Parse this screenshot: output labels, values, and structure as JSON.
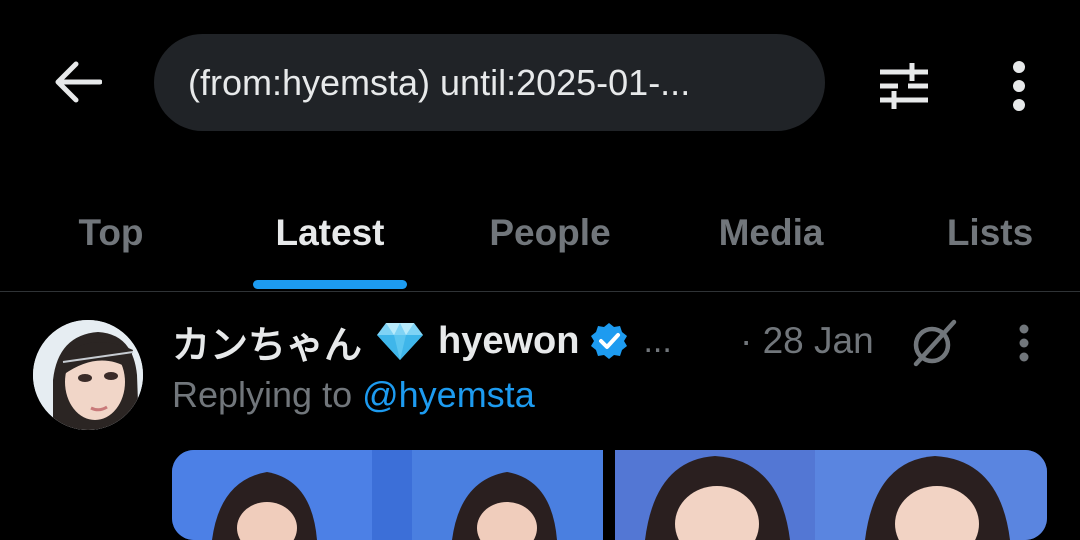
{
  "search": {
    "query": "(from:hyemsta) until:2025-01-..."
  },
  "tabs": [
    {
      "label": "Top",
      "active": false
    },
    {
      "label": "Latest",
      "active": true
    },
    {
      "label": "People",
      "active": false
    },
    {
      "label": "Media",
      "active": false
    },
    {
      "label": "Lists",
      "active": false
    }
  ],
  "tweet": {
    "display_name": "カンちゃん",
    "name_emoji": "💎",
    "username": "hyewon",
    "verified": true,
    "truncation": "...",
    "timestamp": "· 28 Jan",
    "reply_prefix": "Replying to ",
    "reply_handle": "@hyemsta"
  },
  "icons": {
    "back": "arrow-left-icon",
    "filter": "sliders-icon",
    "more": "vertical-dots-icon",
    "grok": "grok-icon"
  },
  "colors": {
    "accent": "#1d9bf0",
    "background": "#000000",
    "secondary_text": "#71767b"
  }
}
